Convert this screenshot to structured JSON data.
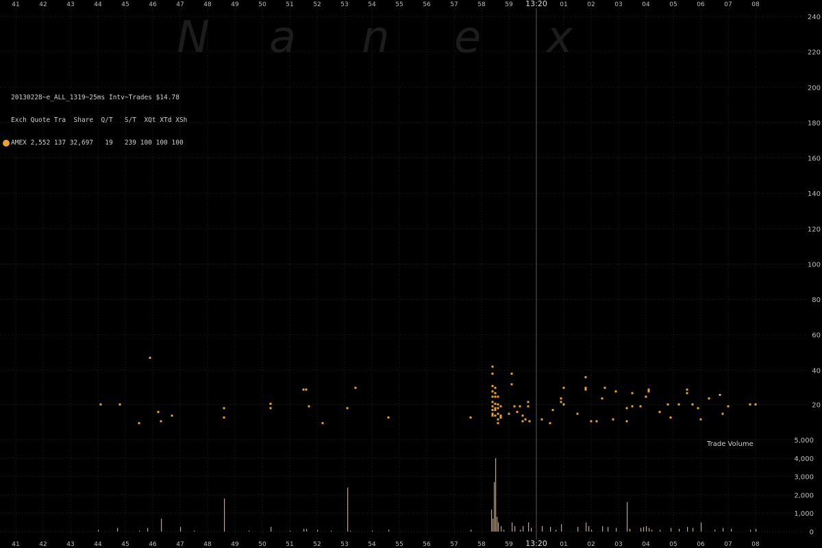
{
  "info": {
    "title": "20130228~e_ALL_1319~25ms Intv~Trades $14.78",
    "header": "Exch Quote Tra  Share  Q/T   S/T  XQt XTd XSh",
    "row": "AMEX 2,552 137 32,697   19   239 100 100 100",
    "series_color": "#e8a23a"
  },
  "watermark": [
    "N",
    "a",
    "n",
    "e",
    "x"
  ],
  "chart_data": [
    {
      "type": "scatter",
      "title": "",
      "xlabel": "",
      "ylabel": "",
      "x_tick_labels": [
        "41",
        "42",
        "43",
        "44",
        "45",
        "46",
        "47",
        "48",
        "49",
        "50",
        "51",
        "52",
        "53",
        "54",
        "55",
        "56",
        "57",
        "58",
        "59",
        "13:20",
        "01",
        "02",
        "03",
        "04",
        "05",
        "06",
        "07",
        "08"
      ],
      "y_tick_labels": [
        "240",
        "220",
        "200",
        "180",
        "160",
        "140",
        "120",
        "100",
        "80",
        "60",
        "40",
        "20"
      ],
      "ylim": [
        0,
        240
      ],
      "grid": true,
      "marker_line_label": "13:20",
      "series": [
        {
          "exchange": "AMEX",
          "color": "#e8a23a",
          "points": [
            [
              44.1,
              20
            ],
            [
              44.8,
              20
            ],
            [
              45.5,
              10
            ],
            [
              45.9,
              47
            ],
            [
              46.2,
              16
            ],
            [
              46.3,
              11
            ],
            [
              46.7,
              14
            ],
            [
              48.6,
              18
            ],
            [
              48.6,
              13
            ],
            [
              50.3,
              21
            ],
            [
              50.3,
              18
            ],
            [
              51.5,
              29
            ],
            [
              51.6,
              29
            ],
            [
              51.7,
              19
            ],
            [
              52.2,
              10
            ],
            [
              53.1,
              18
            ],
            [
              53.4,
              30
            ],
            [
              54.6,
              13
            ],
            [
              57.6,
              13
            ],
            [
              58.4,
              42
            ],
            [
              58.4,
              38
            ],
            [
              58.4,
              31
            ],
            [
              58.5,
              30
            ],
            [
              58.4,
              28
            ],
            [
              58.5,
              27
            ],
            [
              58.4,
              25
            ],
            [
              58.5,
              25
            ],
            [
              58.6,
              25
            ],
            [
              58.4,
              22
            ],
            [
              58.5,
              21
            ],
            [
              58.6,
              20
            ],
            [
              58.4,
              19
            ],
            [
              58.5,
              18
            ],
            [
              58.6,
              18
            ],
            [
              58.7,
              19
            ],
            [
              58.4,
              17
            ],
            [
              58.5,
              17
            ],
            [
              58.4,
              15
            ],
            [
              58.6,
              15
            ],
            [
              58.4,
              14
            ],
            [
              58.5,
              14
            ],
            [
              58.7,
              14
            ],
            [
              58.6,
              12
            ],
            [
              58.7,
              13
            ],
            [
              58.6,
              10
            ],
            [
              59.1,
              38
            ],
            [
              59.1,
              32
            ],
            [
              59.2,
              19
            ],
            [
              59.3,
              16
            ],
            [
              59.4,
              19
            ],
            [
              59.0,
              15
            ],
            [
              59.5,
              14
            ],
            [
              59.5,
              11
            ],
            [
              59.6,
              12
            ],
            [
              59.7,
              22
            ],
            [
              59.7,
              19
            ],
            [
              59.75,
              11
            ],
            [
              60.2,
              12
            ],
            [
              60.5,
              10
            ],
            [
              60.6,
              17
            ],
            [
              60.9,
              24
            ],
            [
              60.9,
              22
            ],
            [
              61.0,
              30
            ],
            [
              61.0,
              20
            ],
            [
              61.5,
              15
            ],
            [
              61.8,
              36
            ],
            [
              61.8,
              30
            ],
            [
              61.8,
              29
            ],
            [
              62.0,
              11
            ],
            [
              62.2,
              11
            ],
            [
              62.4,
              24
            ],
            [
              62.5,
              30
            ],
            [
              62.8,
              12
            ],
            [
              62.9,
              28
            ],
            [
              63.3,
              18
            ],
            [
              63.3,
              11
            ],
            [
              63.5,
              19
            ],
            [
              63.5,
              27
            ],
            [
              63.8,
              19
            ],
            [
              64.0,
              25
            ],
            [
              64.1,
              29
            ],
            [
              64.1,
              28
            ],
            [
              64.5,
              16
            ],
            [
              64.8,
              20
            ],
            [
              64.9,
              13
            ],
            [
              65.2,
              20
            ],
            [
              65.5,
              29
            ],
            [
              65.5,
              27
            ],
            [
              65.7,
              20
            ],
            [
              65.9,
              18
            ],
            [
              66.0,
              12
            ],
            [
              66.3,
              24
            ],
            [
              66.7,
              26
            ],
            [
              66.8,
              15
            ],
            [
              67.0,
              19
            ],
            [
              67.8,
              20
            ],
            [
              68.0,
              20
            ]
          ]
        }
      ]
    },
    {
      "type": "bar",
      "title": "Trade Volume",
      "xlabel": "",
      "ylabel": "",
      "y_tick_labels": [
        "5,000",
        "4,000",
        "3,000",
        "2,000",
        "1,000",
        "0"
      ],
      "ylim": [
        0,
        5000
      ],
      "series": [
        {
          "name": "Trade Volume",
          "color": "#e8a23a",
          "bars": [
            [
              44.0,
              100
            ],
            [
              44.7,
              200
            ],
            [
              45.5,
              50
            ],
            [
              45.8,
              200
            ],
            [
              46.3,
              700
            ],
            [
              47.0,
              250
            ],
            [
              47.5,
              50
            ],
            [
              48.6,
              1800
            ],
            [
              49.5,
              50
            ],
            [
              50.3,
              250
            ],
            [
              51.0,
              50
            ],
            [
              51.5,
              150
            ],
            [
              51.6,
              150
            ],
            [
              52.0,
              100
            ],
            [
              52.5,
              50
            ],
            [
              53.1,
              2400
            ],
            [
              53.2,
              50
            ],
            [
              54.0,
              50
            ],
            [
              54.6,
              100
            ],
            [
              57.6,
              100
            ],
            [
              58.35,
              1200
            ],
            [
              58.4,
              700
            ],
            [
              58.45,
              2700
            ],
            [
              58.5,
              4000
            ],
            [
              58.55,
              800
            ],
            [
              58.6,
              500
            ],
            [
              58.7,
              300
            ],
            [
              58.8,
              100
            ],
            [
              59.1,
              500
            ],
            [
              59.2,
              300
            ],
            [
              59.4,
              100
            ],
            [
              59.5,
              300
            ],
            [
              59.7,
              500
            ],
            [
              59.8,
              200
            ],
            [
              60.2,
              300
            ],
            [
              60.5,
              250
            ],
            [
              60.7,
              100
            ],
            [
              60.9,
              400
            ],
            [
              61.5,
              250
            ],
            [
              61.8,
              500
            ],
            [
              61.9,
              300
            ],
            [
              62.0,
              100
            ],
            [
              62.4,
              300
            ],
            [
              62.6,
              250
            ],
            [
              62.9,
              200
            ],
            [
              63.3,
              1600
            ],
            [
              63.4,
              150
            ],
            [
              63.8,
              200
            ],
            [
              63.9,
              250
            ],
            [
              64.0,
              300
            ],
            [
              64.1,
              200
            ],
            [
              64.2,
              100
            ],
            [
              64.5,
              100
            ],
            [
              64.9,
              200
            ],
            [
              65.2,
              150
            ],
            [
              65.5,
              250
            ],
            [
              65.7,
              200
            ],
            [
              66.0,
              500
            ],
            [
              66.5,
              100
            ],
            [
              66.8,
              200
            ],
            [
              67.1,
              150
            ],
            [
              67.8,
              100
            ],
            [
              68.0,
              150
            ]
          ]
        }
      ]
    }
  ]
}
